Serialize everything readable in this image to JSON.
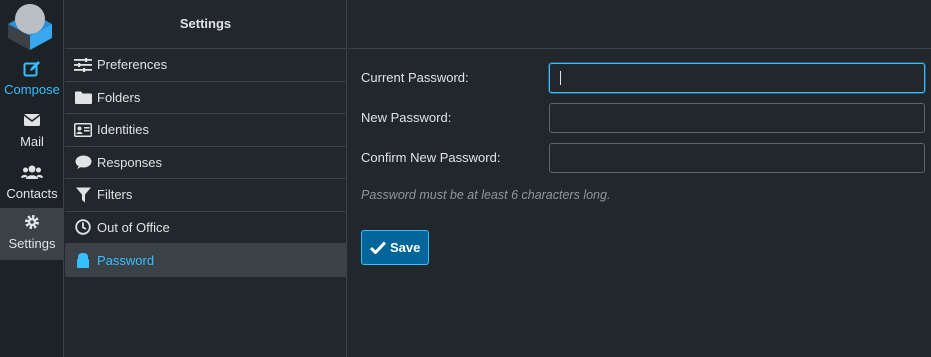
{
  "taskmenu": {
    "compose": {
      "label": "Compose",
      "icon": "compose-icon"
    },
    "mail": {
      "label": "Mail",
      "icon": "envelope-icon"
    },
    "contacts": {
      "label": "Contacts",
      "icon": "users-icon"
    },
    "settings": {
      "label": "Settings",
      "icon": "gear-icon"
    }
  },
  "settings_list": {
    "title": "Settings",
    "items": [
      {
        "label": "Preferences",
        "icon": "sliders-icon"
      },
      {
        "label": "Folders",
        "icon": "folder-icon"
      },
      {
        "label": "Identities",
        "icon": "id-card-icon"
      },
      {
        "label": "Responses",
        "icon": "comment-icon"
      },
      {
        "label": "Filters",
        "icon": "filter-icon"
      },
      {
        "label": "Out of Office",
        "icon": "clock-icon"
      },
      {
        "label": "Password",
        "icon": "lock-icon",
        "selected": true
      }
    ]
  },
  "form": {
    "current_password_label": "Current Password:",
    "new_password_label": "New Password:",
    "confirm_password_label": "Confirm New Password:",
    "current_password_value": "",
    "new_password_value": "",
    "confirm_password_value": "",
    "hint": "Password must be at least 6 characters long.",
    "save_label": "Save"
  },
  "colors": {
    "accent": "#37beff",
    "background": "#22272b",
    "button": "#00669a"
  }
}
